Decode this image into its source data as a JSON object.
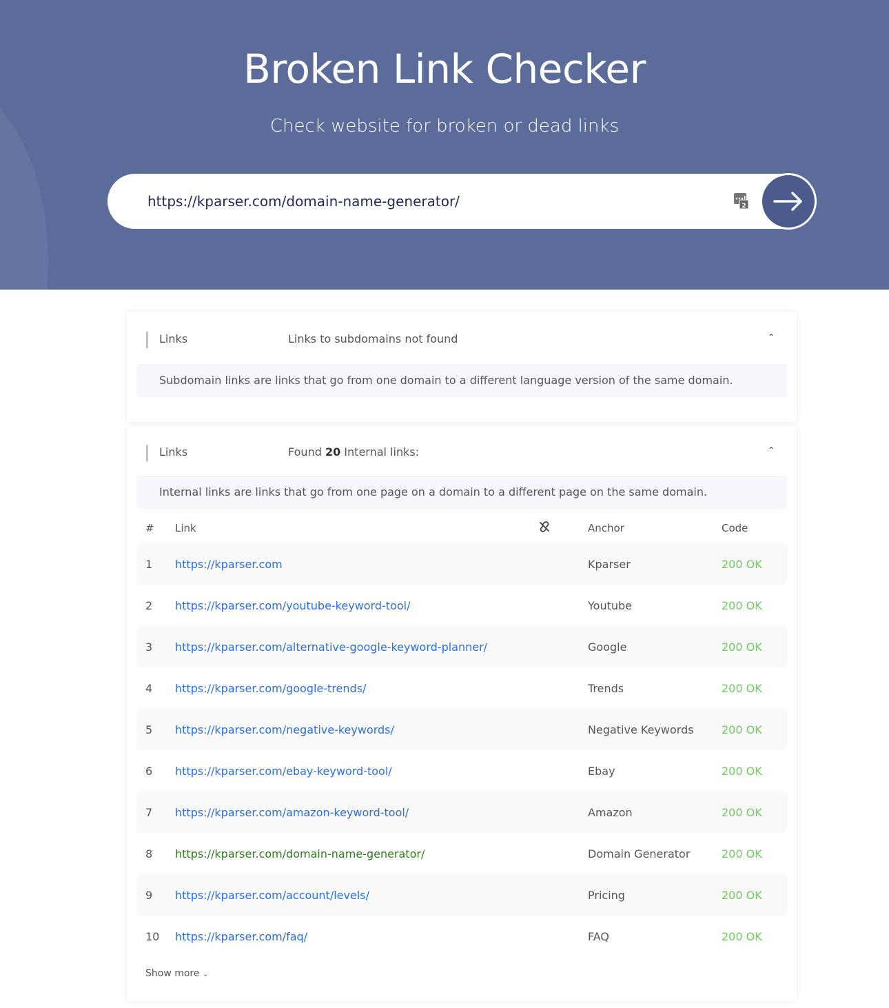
{
  "header": {
    "title": "Broken Link Checker",
    "subtitle": "Check website for broken or dead links"
  },
  "search": {
    "value": "https://kparser.com/domain-name-generator/",
    "keyboard_icon": "keyboard-counter-icon",
    "submit_icon": "arrow-right-icon"
  },
  "subdomain_section": {
    "label": "Links",
    "title": "Links to subdomains not found",
    "note": "Subdomain links are links that go from one domain to a different language version of the same domain."
  },
  "internal_section": {
    "label": "Links",
    "title_prefix": "Found ",
    "count": "20",
    "title_suffix": " Internal links:",
    "note": "Internal links are links that go from one page on a domain to a different page on the same domain.",
    "columns": {
      "num": "#",
      "link": "Link",
      "anchor": "Anchor",
      "code": "Code"
    },
    "rows": [
      {
        "n": "1",
        "link": "https://kparser.com",
        "anchor": "Kparser",
        "code": "200 OK"
      },
      {
        "n": "2",
        "link": "https://kparser.com/youtube-keyword-tool/",
        "anchor": "Youtube",
        "code": "200 OK"
      },
      {
        "n": "3",
        "link": "https://kparser.com/alternative-google-keyword-planner/",
        "anchor": "Google",
        "code": "200 OK"
      },
      {
        "n": "4",
        "link": "https://kparser.com/google-trends/",
        "anchor": "Trends",
        "code": "200 OK"
      },
      {
        "n": "5",
        "link": "https://kparser.com/negative-keywords/",
        "anchor": "Negative Keywords",
        "code": "200 OK"
      },
      {
        "n": "6",
        "link": "https://kparser.com/ebay-keyword-tool/",
        "anchor": "Ebay",
        "code": "200 OK"
      },
      {
        "n": "7",
        "link": "https://kparser.com/amazon-keyword-tool/",
        "anchor": "Amazon",
        "code": "200 OK"
      },
      {
        "n": "8",
        "link": "https://kparser.com/domain-name-generator/",
        "anchor": "Domain Generator",
        "code": "200 OK",
        "current": true
      },
      {
        "n": "9",
        "link": "https://kparser.com/account/levels/",
        "anchor": "Pricing",
        "code": "200 OK"
      },
      {
        "n": "10",
        "link": "https://kparser.com/faq/",
        "anchor": "FAQ",
        "code": "200 OK"
      }
    ],
    "show_more": "Show more"
  },
  "colors": {
    "header_bg": "#5b6c9b",
    "link": "#2b6ee6",
    "current_link": "#2f7d1f",
    "ok": "#6ccf5d"
  }
}
